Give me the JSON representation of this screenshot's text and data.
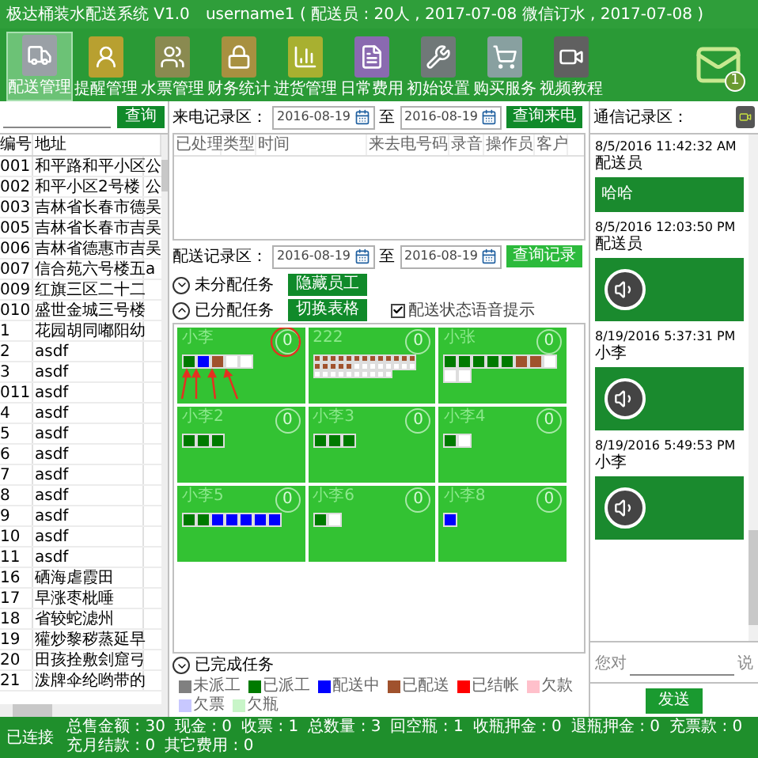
{
  "window": {
    "title": "极达桶装水配送系统 V1.0",
    "user_info": "username1 ( 配送员 : 20人 , 2017-07-08  微信订水 , 2017-07-08 )"
  },
  "toolbar": [
    {
      "label": "配送管理",
      "kind": "truck",
      "selected": true
    },
    {
      "label": "提醒管理",
      "kind": "person",
      "selected": false
    },
    {
      "label": "水票管理",
      "kind": "ticket",
      "selected": false
    },
    {
      "label": "财务统计",
      "kind": "lock",
      "selected": false
    },
    {
      "label": "进货管理",
      "kind": "chart",
      "selected": false
    },
    {
      "label": "日常费用",
      "kind": "file",
      "selected": false
    },
    {
      "label": "初始设置",
      "kind": "tools",
      "selected": false
    },
    {
      "label": "购买服务",
      "kind": "cart",
      "selected": false
    },
    {
      "label": "视频教程",
      "kind": "video",
      "selected": false
    }
  ],
  "notifications": {
    "count": "1"
  },
  "customer_panel": {
    "search_button": "查询",
    "columns": [
      "编号",
      "地址"
    ],
    "rows": [
      {
        "id": "001",
        "address": "和平路和平小区",
        "column_3": "公"
      },
      {
        "id": "002",
        "address": "和平小区2号楼",
        "column_3": "公"
      },
      {
        "id": "003",
        "address": "吉林省长春市德",
        "column_3": "吴"
      },
      {
        "id": "005",
        "address": "吉林省长春市吉",
        "column_3": "吴"
      },
      {
        "id": "006",
        "address": "吉林省德惠市吉",
        "column_3": "吴"
      },
      {
        "id": "007",
        "address": "信合苑六号楼五",
        "column_3": "a"
      },
      {
        "id": "009",
        "address": "红旗三区二十二"
      },
      {
        "id": "010",
        "address": "盛世金城三号楼"
      },
      {
        "id": "1",
        "address": "花园胡同嘟阳幼"
      },
      {
        "id": "2",
        "address": "asdf"
      },
      {
        "id": "3",
        "address": "asdf"
      },
      {
        "id": "011",
        "address": "asdf"
      },
      {
        "id": "4",
        "address": "asdf"
      },
      {
        "id": "5",
        "address": "asdf"
      },
      {
        "id": "6",
        "address": "asdf"
      },
      {
        "id": "7",
        "address": "asdf"
      },
      {
        "id": "8",
        "address": "asdf"
      },
      {
        "id": "9",
        "address": "asdf"
      },
      {
        "id": "10",
        "address": "asdf"
      },
      {
        "id": "11",
        "address": "asdf"
      },
      {
        "id": "16",
        "address": "硒海虐霞田"
      },
      {
        "id": "17",
        "address": "早涨枣枇唾"
      },
      {
        "id": "18",
        "address": "省较蛇滤州"
      },
      {
        "id": "19",
        "address": "獾炒黎秽蒸延早"
      },
      {
        "id": "20",
        "address": "田孩拴敷刽窟弓"
      },
      {
        "id": "21",
        "address": "泼牌伞纶哟带的"
      }
    ]
  },
  "call_records": {
    "label": "来电记录区：",
    "date_from": "2016-08-19",
    "to_label": "至",
    "date_to": "2016-08-19",
    "button": "查询来电",
    "columns": [
      "已处理",
      "类型",
      "时间",
      "来去电号码",
      "录音",
      "操作员",
      "客户"
    ]
  },
  "delivery_records": {
    "label": "配送记录区：",
    "date_from": "2016-08-19",
    "to_label": "至",
    "date_to": "2016-08-19",
    "button": "查询记录"
  },
  "sections": [
    {
      "label": "未分配任务",
      "expanded": false,
      "button": "隐藏员工"
    },
    {
      "label": "已分配任务",
      "expanded": true,
      "button": "切换表格",
      "checkbox": {
        "label": "配送状态语音提示",
        "checked": true
      }
    }
  ],
  "cards": [
    {
      "name": "小李",
      "count": "0",
      "tasks": [
        {
          "kind": "dispatched"
        },
        {
          "kind": "delivering"
        },
        {
          "kind": "delivered"
        },
        {
          "kind": "blank"
        },
        {
          "kind": "blank"
        }
      ]
    },
    {
      "name": "222",
      "count": "0",
      "tasks": [
        {
          "kind": "delivered"
        },
        {
          "kind": "delivered"
        },
        {
          "kind": "delivered"
        },
        {
          "kind": "delivered"
        },
        {
          "kind": "delivered"
        },
        {
          "kind": "delivered"
        },
        {
          "kind": "delivered"
        },
        {
          "kind": "delivered"
        },
        {
          "kind": "delivered"
        },
        {
          "kind": "delivered"
        },
        {
          "kind": "delivered"
        },
        {
          "kind": "delivered"
        },
        {
          "kind": "delivered"
        },
        {
          "kind": "delivered"
        },
        {
          "kind": "delivered"
        },
        {
          "kind": "delivered"
        },
        {
          "kind": "delivered"
        },
        {
          "kind": "delivered"
        },
        {
          "kind": "blank"
        },
        {
          "kind": "blank"
        },
        {
          "kind": "blank"
        },
        {
          "kind": "blank"
        },
        {
          "kind": "blank"
        },
        {
          "kind": "blank"
        },
        {
          "kind": "blank"
        },
        {
          "kind": "blank"
        },
        {
          "kind": "blank"
        },
        {
          "kind": "blank"
        },
        {
          "kind": "blank"
        },
        {
          "kind": "blank"
        },
        {
          "kind": "blank"
        },
        {
          "kind": "blank"
        },
        {
          "kind": "blank"
        },
        {
          "kind": "blank"
        },
        {
          "kind": "blank"
        },
        {
          "kind": "blank"
        }
      ]
    },
    {
      "name": "小张",
      "count": "0",
      "tasks": [
        {
          "kind": "dispatched"
        },
        {
          "kind": "dispatched"
        },
        {
          "kind": "dispatched"
        },
        {
          "kind": "dispatched"
        },
        {
          "kind": "dispatched"
        },
        {
          "kind": "delivered"
        },
        {
          "kind": "delivered"
        },
        {
          "kind": "blank"
        },
        {
          "kind": "blank"
        },
        {
          "kind": "blank"
        }
      ]
    },
    {
      "name": "小李2",
      "count": "0",
      "tasks": [
        {
          "kind": "dispatched"
        },
        {
          "kind": "dispatched"
        },
        {
          "kind": "dispatched"
        }
      ]
    },
    {
      "name": "小李3",
      "count": "0",
      "tasks": [
        {
          "kind": "dispatched"
        },
        {
          "kind": "dispatched"
        },
        {
          "kind": "dispatched"
        }
      ]
    },
    {
      "name": "小李4",
      "count": "0",
      "tasks": [
        {
          "kind": "dispatched"
        },
        {
          "kind": "blank"
        }
      ]
    },
    {
      "name": "小李5",
      "count": "0",
      "tasks": [
        {
          "kind": "dispatched"
        },
        {
          "kind": "dispatched"
        },
        {
          "kind": "delivering"
        },
        {
          "kind": "delivering"
        },
        {
          "kind": "delivering"
        },
        {
          "kind": "delivering"
        },
        {
          "kind": "delivering"
        }
      ]
    },
    {
      "name": "小李6",
      "count": "0",
      "tasks": [
        {
          "kind": "dispatched"
        },
        {
          "kind": "blank"
        }
      ]
    },
    {
      "name": "小李8",
      "count": "0",
      "tasks": [
        {
          "kind": "delivering"
        }
      ]
    }
  ],
  "completed_section": {
    "label": "已完成任务",
    "expanded": false
  },
  "legend": [
    {
      "label": "未派工",
      "kind": "undispatched",
      "color": "#808080"
    },
    {
      "label": "已派工",
      "kind": "dispatched",
      "color": "#007a00"
    },
    {
      "label": "配送中",
      "kind": "delivering",
      "color": "#0000ff"
    },
    {
      "label": "已配送",
      "kind": "delivered",
      "color": "#a0522d"
    },
    {
      "label": "已结帐",
      "kind": "settled",
      "color": "#ff0000"
    },
    {
      "label": "欠款",
      "kind": "owes_money",
      "color": "#ffc0cb"
    },
    {
      "label": "欠票",
      "kind": "owes_ticket",
      "color": "#c8c8ff"
    },
    {
      "label": "欠瓶",
      "kind": "owes_bottle",
      "color": "#c8f5c8"
    }
  ],
  "messages_panel": {
    "label": "通信记录区：",
    "messages": [
      {
        "time": "8/5/2016 11:42:32 AM",
        "sender": "配送员",
        "kind": "text",
        "text": "哈哈"
      },
      {
        "time": "8/5/2016 12:03:50 PM",
        "sender": "配送员",
        "kind": "voice"
      },
      {
        "time": "8/19/2016 5:37:31 PM",
        "sender": "小李",
        "kind": "voice"
      },
      {
        "time": "8/19/2016 5:49:53 PM",
        "sender": "小李",
        "kind": "voice"
      }
    ],
    "input_prefix": "您对",
    "input_suffix": "说",
    "send_button": "发送"
  },
  "status_bar": {
    "connection": "已连接",
    "totals": [
      "总售金额 : 30",
      "现金 : 0",
      "收票 : 1",
      "总数量 : 3",
      "回空瓶 : 1",
      "收瓶押金 : 0",
      "退瓶押金 : 0",
      "充票款 : 0",
      "充月结款 : 0",
      "其它费用 : 0"
    ]
  }
}
